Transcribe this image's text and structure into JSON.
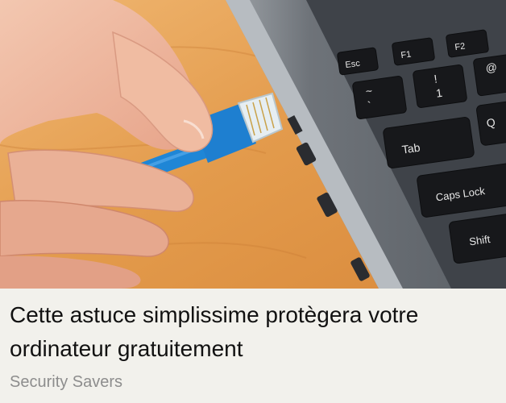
{
  "ad": {
    "image_alt": "Hand plugging a blue ethernet cable into a laptop",
    "headline": "Cette astuce simplissime protègera votre ordinateur gratuitement",
    "source": "Security Savers"
  },
  "keys": {
    "esc": "Esc",
    "f1": "F1",
    "f2": "F2",
    "tilde": "~",
    "backtick": "`",
    "excl": "!",
    "one": "1",
    "at": "@",
    "q": "Q",
    "tab": "Tab",
    "capslock": "Caps Lock",
    "shift": "Shift"
  },
  "colors": {
    "background": "#f2f1ec",
    "headline": "#111111",
    "source": "#8d8d8d",
    "cable": "#1f86d6"
  }
}
